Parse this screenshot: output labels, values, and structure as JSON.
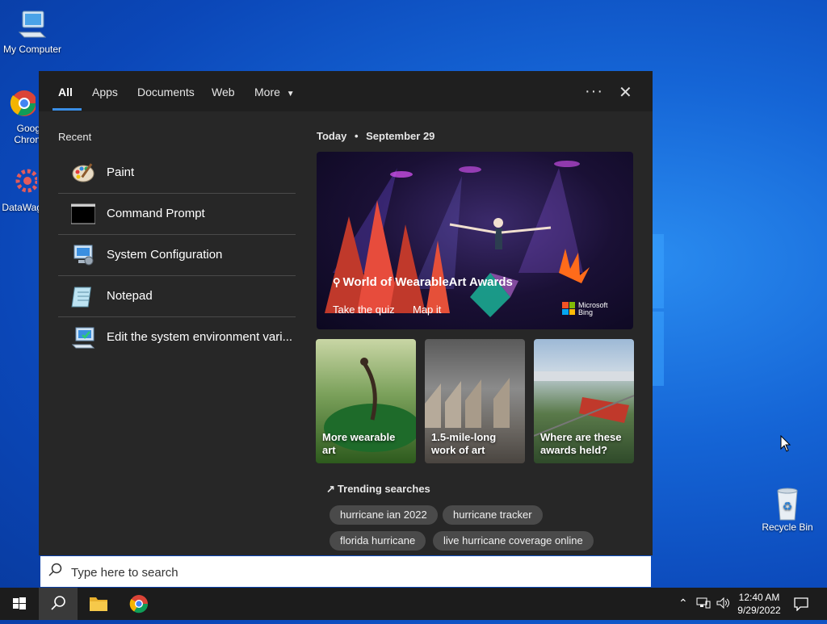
{
  "desktop": {
    "icons": [
      {
        "label": "My Computer"
      },
      {
        "label": "Goog Chron"
      },
      {
        "label": "DataWag"
      },
      {
        "label": "Recycle Bin"
      }
    ]
  },
  "search_panel": {
    "tabs": [
      {
        "label": "All",
        "active": true
      },
      {
        "label": "Apps"
      },
      {
        "label": "Documents"
      },
      {
        "label": "Web"
      },
      {
        "label": "More"
      }
    ],
    "more_options_icon": "ellipsis-icon",
    "close_icon": "close-icon",
    "recent": {
      "heading": "Recent",
      "items": [
        {
          "label": "Paint",
          "icon": "paint-icon"
        },
        {
          "label": "Command Prompt",
          "icon": "cmd-icon"
        },
        {
          "label": "System Configuration",
          "icon": "msconfig-icon"
        },
        {
          "label": "Notepad",
          "icon": "notepad-icon"
        },
        {
          "label": "Edit the system environment vari...",
          "icon": "system-properties-icon"
        }
      ]
    },
    "today": {
      "label": "Today",
      "separator": "•",
      "date": "September 29",
      "hero": {
        "title": "World of WearableArt Awards",
        "links": [
          "Take the quiz",
          "Map it"
        ],
        "brand_line1": "Microsoft",
        "brand_line2": "Bing"
      },
      "cards": [
        {
          "caption": "More wearable art"
        },
        {
          "caption": "1.5-mile-long work of art"
        },
        {
          "caption": "Where are these awards held?"
        }
      ]
    },
    "trending": {
      "heading": "Trending searches",
      "chips": [
        "hurricane ian 2022",
        "hurricane tracker",
        "florida hurricane",
        "live hurricane coverage online"
      ]
    }
  },
  "search_bar": {
    "placeholder": "Type here to search"
  },
  "taskbar": {
    "time": "12:40 AM",
    "date": "9/29/2022",
    "colors": {
      "bg": "#1c1c1c",
      "accent": "#3a8ee6"
    }
  }
}
